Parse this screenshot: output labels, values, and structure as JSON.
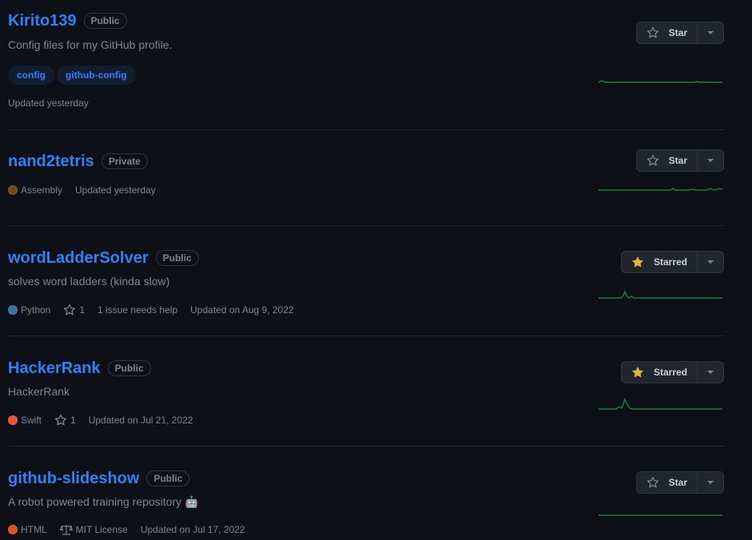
{
  "repos": [
    {
      "name": "Kirito139",
      "visibility": "Public",
      "description": "Config files for my GitHub profile.",
      "topics": [
        "config",
        "github-config"
      ],
      "updated": "Updated yesterday",
      "star_label": "Star",
      "starred": false
    },
    {
      "name": "nand2tetris",
      "visibility": "Private",
      "language": "Assembly",
      "language_color": "#6E4C13",
      "updated": "Updated yesterday",
      "star_label": "Star",
      "starred": false
    },
    {
      "name": "wordLadderSolver",
      "visibility": "Public",
      "description": "solves word ladders (kinda slow)",
      "language": "Python",
      "language_color": "#3572A5",
      "stars": "1",
      "issues": "1 issue needs help",
      "updated": "Updated on Aug 9, 2022",
      "star_label": "Starred",
      "starred": true
    },
    {
      "name": "HackerRank",
      "visibility": "Public",
      "description": "HackerRank",
      "language": "Swift",
      "language_color": "#F05138",
      "stars": "1",
      "updated": "Updated on Jul 21, 2022",
      "star_label": "Starred",
      "starred": true
    },
    {
      "name": "github-slideshow",
      "visibility": "Public",
      "description": "A robot powered training repository 🤖",
      "language": "HTML",
      "language_color": "#e34c26",
      "license": "MIT License",
      "updated": "Updated on Jul 17, 2022",
      "star_label": "Star",
      "starred": false
    }
  ],
  "colors": {
    "link": "#2f81f7",
    "starred": "#e3b341",
    "sparkline": "#1a7f37"
  },
  "icons": {
    "star": "star-icon",
    "star_fill": "star-fill-icon",
    "caret": "triangle-down-icon",
    "law": "law-icon"
  }
}
